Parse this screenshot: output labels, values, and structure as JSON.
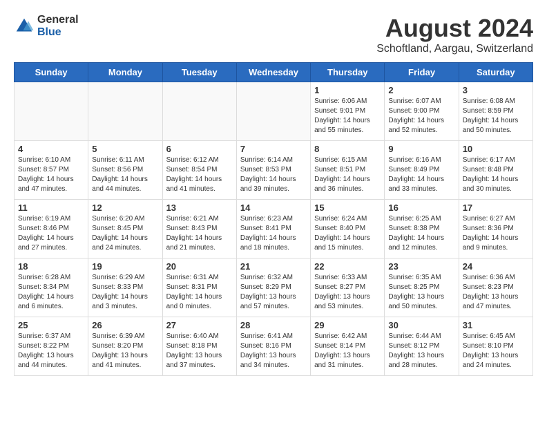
{
  "header": {
    "logo_general": "General",
    "logo_blue": "Blue",
    "main_title": "August 2024",
    "subtitle": "Schoftland, Aargau, Switzerland"
  },
  "calendar": {
    "days_of_week": [
      "Sunday",
      "Monday",
      "Tuesday",
      "Wednesday",
      "Thursday",
      "Friday",
      "Saturday"
    ],
    "weeks": [
      [
        {
          "day": "",
          "info": ""
        },
        {
          "day": "",
          "info": ""
        },
        {
          "day": "",
          "info": ""
        },
        {
          "day": "",
          "info": ""
        },
        {
          "day": "1",
          "info": "Sunrise: 6:06 AM\nSunset: 9:01 PM\nDaylight: 14 hours\nand 55 minutes."
        },
        {
          "day": "2",
          "info": "Sunrise: 6:07 AM\nSunset: 9:00 PM\nDaylight: 14 hours\nand 52 minutes."
        },
        {
          "day": "3",
          "info": "Sunrise: 6:08 AM\nSunset: 8:59 PM\nDaylight: 14 hours\nand 50 minutes."
        }
      ],
      [
        {
          "day": "4",
          "info": "Sunrise: 6:10 AM\nSunset: 8:57 PM\nDaylight: 14 hours\nand 47 minutes."
        },
        {
          "day": "5",
          "info": "Sunrise: 6:11 AM\nSunset: 8:56 PM\nDaylight: 14 hours\nand 44 minutes."
        },
        {
          "day": "6",
          "info": "Sunrise: 6:12 AM\nSunset: 8:54 PM\nDaylight: 14 hours\nand 41 minutes."
        },
        {
          "day": "7",
          "info": "Sunrise: 6:14 AM\nSunset: 8:53 PM\nDaylight: 14 hours\nand 39 minutes."
        },
        {
          "day": "8",
          "info": "Sunrise: 6:15 AM\nSunset: 8:51 PM\nDaylight: 14 hours\nand 36 minutes."
        },
        {
          "day": "9",
          "info": "Sunrise: 6:16 AM\nSunset: 8:49 PM\nDaylight: 14 hours\nand 33 minutes."
        },
        {
          "day": "10",
          "info": "Sunrise: 6:17 AM\nSunset: 8:48 PM\nDaylight: 14 hours\nand 30 minutes."
        }
      ],
      [
        {
          "day": "11",
          "info": "Sunrise: 6:19 AM\nSunset: 8:46 PM\nDaylight: 14 hours\nand 27 minutes."
        },
        {
          "day": "12",
          "info": "Sunrise: 6:20 AM\nSunset: 8:45 PM\nDaylight: 14 hours\nand 24 minutes."
        },
        {
          "day": "13",
          "info": "Sunrise: 6:21 AM\nSunset: 8:43 PM\nDaylight: 14 hours\nand 21 minutes."
        },
        {
          "day": "14",
          "info": "Sunrise: 6:23 AM\nSunset: 8:41 PM\nDaylight: 14 hours\nand 18 minutes."
        },
        {
          "day": "15",
          "info": "Sunrise: 6:24 AM\nSunset: 8:40 PM\nDaylight: 14 hours\nand 15 minutes."
        },
        {
          "day": "16",
          "info": "Sunrise: 6:25 AM\nSunset: 8:38 PM\nDaylight: 14 hours\nand 12 minutes."
        },
        {
          "day": "17",
          "info": "Sunrise: 6:27 AM\nSunset: 8:36 PM\nDaylight: 14 hours\nand 9 minutes."
        }
      ],
      [
        {
          "day": "18",
          "info": "Sunrise: 6:28 AM\nSunset: 8:34 PM\nDaylight: 14 hours\nand 6 minutes."
        },
        {
          "day": "19",
          "info": "Sunrise: 6:29 AM\nSunset: 8:33 PM\nDaylight: 14 hours\nand 3 minutes."
        },
        {
          "day": "20",
          "info": "Sunrise: 6:31 AM\nSunset: 8:31 PM\nDaylight: 14 hours\nand 0 minutes."
        },
        {
          "day": "21",
          "info": "Sunrise: 6:32 AM\nSunset: 8:29 PM\nDaylight: 13 hours\nand 57 minutes."
        },
        {
          "day": "22",
          "info": "Sunrise: 6:33 AM\nSunset: 8:27 PM\nDaylight: 13 hours\nand 53 minutes."
        },
        {
          "day": "23",
          "info": "Sunrise: 6:35 AM\nSunset: 8:25 PM\nDaylight: 13 hours\nand 50 minutes."
        },
        {
          "day": "24",
          "info": "Sunrise: 6:36 AM\nSunset: 8:23 PM\nDaylight: 13 hours\nand 47 minutes."
        }
      ],
      [
        {
          "day": "25",
          "info": "Sunrise: 6:37 AM\nSunset: 8:22 PM\nDaylight: 13 hours\nand 44 minutes."
        },
        {
          "day": "26",
          "info": "Sunrise: 6:39 AM\nSunset: 8:20 PM\nDaylight: 13 hours\nand 41 minutes."
        },
        {
          "day": "27",
          "info": "Sunrise: 6:40 AM\nSunset: 8:18 PM\nDaylight: 13 hours\nand 37 minutes."
        },
        {
          "day": "28",
          "info": "Sunrise: 6:41 AM\nSunset: 8:16 PM\nDaylight: 13 hours\nand 34 minutes."
        },
        {
          "day": "29",
          "info": "Sunrise: 6:42 AM\nSunset: 8:14 PM\nDaylight: 13 hours\nand 31 minutes."
        },
        {
          "day": "30",
          "info": "Sunrise: 6:44 AM\nSunset: 8:12 PM\nDaylight: 13 hours\nand 28 minutes."
        },
        {
          "day": "31",
          "info": "Sunrise: 6:45 AM\nSunset: 8:10 PM\nDaylight: 13 hours\nand 24 minutes."
        }
      ]
    ]
  }
}
